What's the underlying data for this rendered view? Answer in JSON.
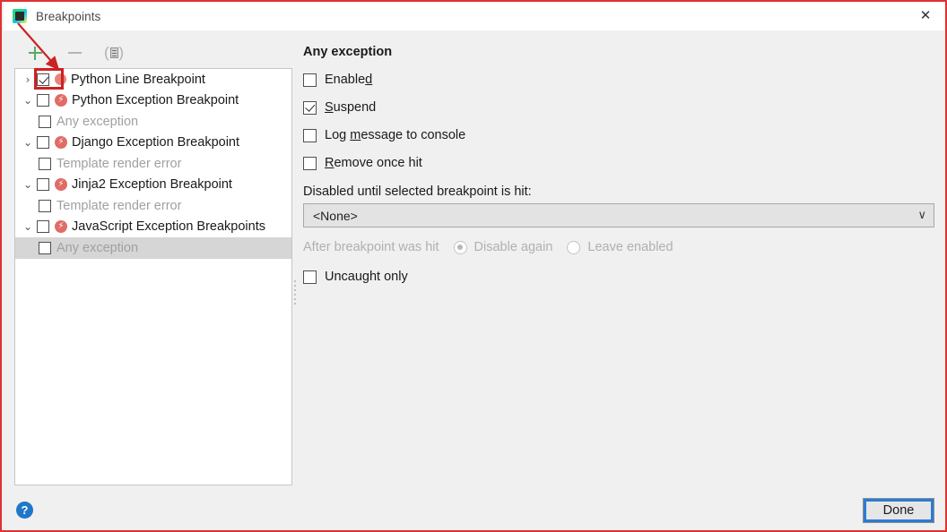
{
  "window": {
    "title": "Breakpoints",
    "app_icon": "pycharm-icon",
    "close_label": "✕"
  },
  "toolbar": {
    "add_label": "+",
    "remove_label": "−",
    "mute_label": "mute-breakpoints"
  },
  "tree": {
    "rows": [
      {
        "label": "Python Line Breakpoint",
        "chevron": "›",
        "checked": true,
        "icon": "line-breakpoint-dot",
        "child": false,
        "selected": false
      },
      {
        "label": "Python Exception Breakpoint",
        "chevron": "⌄",
        "checked": false,
        "icon": "exception-breakpoint",
        "child": false,
        "selected": false
      },
      {
        "label": "Any exception",
        "chevron": "",
        "checked": false,
        "icon": "",
        "child": true,
        "selected": false
      },
      {
        "label": "Django Exception Breakpoint",
        "chevron": "⌄",
        "checked": false,
        "icon": "exception-breakpoint",
        "child": false,
        "selected": false
      },
      {
        "label": "Template render error",
        "chevron": "",
        "checked": false,
        "icon": "",
        "child": true,
        "selected": false
      },
      {
        "label": "Jinja2 Exception Breakpoint",
        "chevron": "⌄",
        "checked": false,
        "icon": "exception-breakpoint",
        "child": false,
        "selected": false
      },
      {
        "label": "Template render error",
        "chevron": "",
        "checked": false,
        "icon": "",
        "child": true,
        "selected": false
      },
      {
        "label": "JavaScript Exception Breakpoints",
        "chevron": "⌄",
        "checked": false,
        "icon": "exception-breakpoint",
        "child": false,
        "selected": false
      },
      {
        "label": "Any exception",
        "chevron": "",
        "checked": false,
        "icon": "",
        "child": true,
        "selected": true
      }
    ]
  },
  "detail": {
    "title": "Any exception",
    "options": [
      {
        "label_before": "Enable",
        "mnemonic": "d",
        "label_after": "",
        "checked": false
      },
      {
        "label_before": "",
        "mnemonic": "S",
        "label_after": "uspend",
        "checked": true
      },
      {
        "label_before": "Log ",
        "mnemonic": "m",
        "label_after": "essage to console",
        "checked": false
      },
      {
        "label_before": "",
        "mnemonic": "R",
        "label_after": "emove once hit",
        "checked": false
      }
    ],
    "disabled_until_label": "Disabled until selected breakpoint is hit:",
    "combo_value": "<None>",
    "combo_caret": "∨",
    "after_hit_label": "After breakpoint was hit",
    "radios": [
      {
        "label": "Disable again",
        "selected": true
      },
      {
        "label": "Leave enabled",
        "selected": false
      }
    ],
    "uncaught_label": "Uncaught only",
    "uncaught_checked": false
  },
  "footer": {
    "help_label": "?",
    "done_label": "Done"
  },
  "colors": {
    "accent_blue": "#2b7cd3",
    "annotation_red": "#cc2222",
    "breakpoint_red": "#e06c65",
    "add_green": "#59a869"
  }
}
